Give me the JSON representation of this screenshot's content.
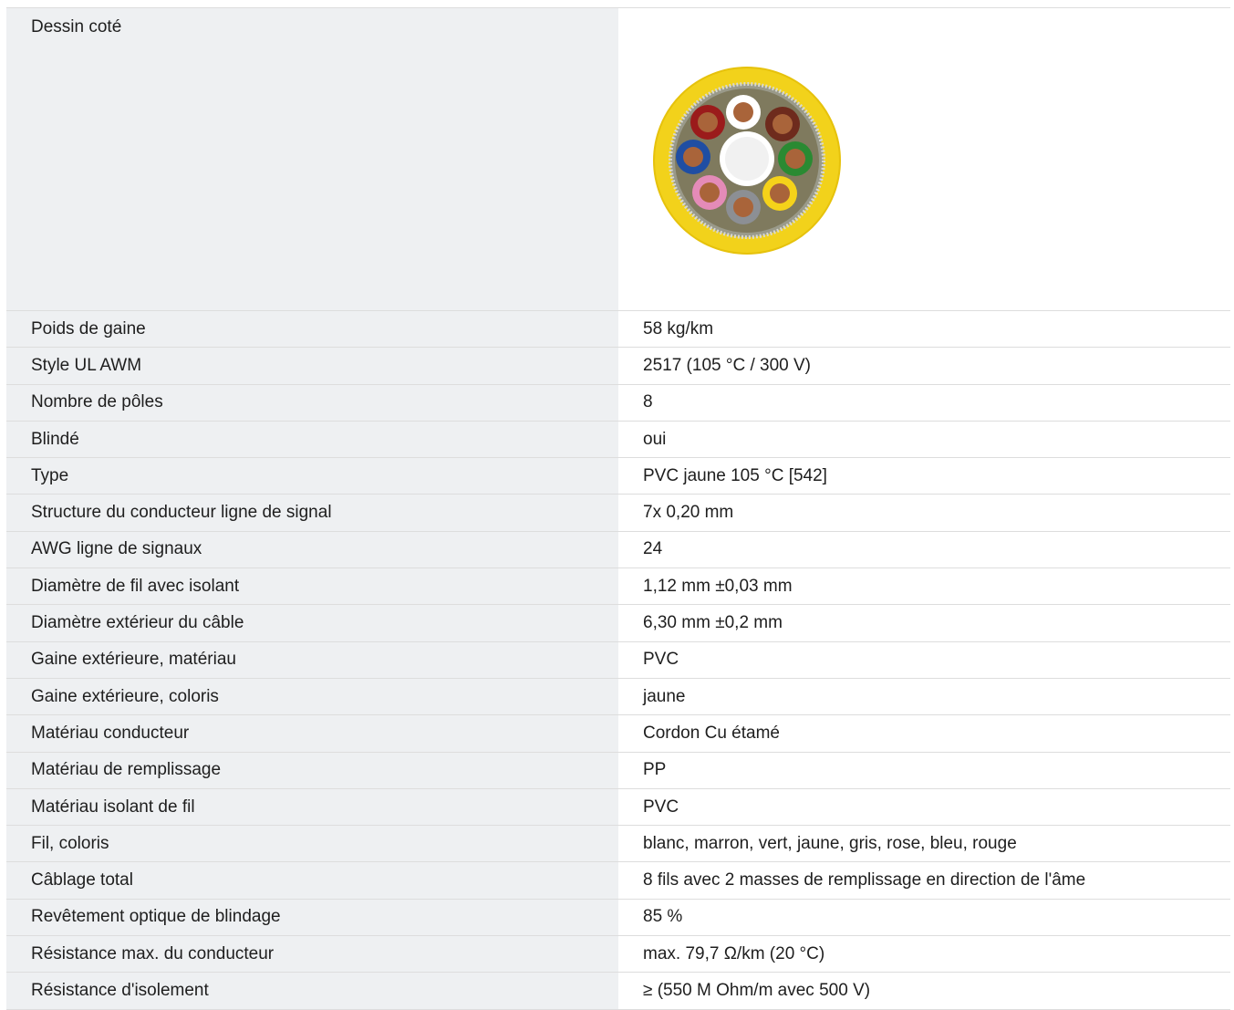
{
  "drawing": {
    "label": "Dessin coté",
    "image_icon": "cable-cross-section-icon"
  },
  "specs": [
    {
      "label": "Poids de gaine",
      "value": "58 kg/km"
    },
    {
      "label": "Style UL AWM",
      "value": "2517 (105 °C / 300 V)"
    },
    {
      "label": "Nombre de pôles",
      "value": "8"
    },
    {
      "label": "Blindé",
      "value": "oui"
    },
    {
      "label": "Type",
      "value": "PVC jaune 105 °C [542]"
    },
    {
      "label": "Structure du conducteur ligne de signal",
      "value": "7x 0,20 mm"
    },
    {
      "label": "AWG ligne de signaux",
      "value": "24"
    },
    {
      "label": "Diamètre de fil avec isolant",
      "value": "1,12 mm ±0,03 mm"
    },
    {
      "label": "Diamètre extérieur du câble",
      "value": "6,30 mm ±0,2 mm"
    },
    {
      "label": "Gaine extérieure, matériau",
      "value": "PVC"
    },
    {
      "label": "Gaine extérieure, coloris",
      "value": "jaune"
    },
    {
      "label": "Matériau conducteur",
      "value": "Cordon Cu étamé"
    },
    {
      "label": "Matériau de remplissage",
      "value": "PP"
    },
    {
      "label": "Matériau isolant de fil",
      "value": "PVC"
    },
    {
      "label": "Fil, coloris",
      "value": "blanc, marron, vert, jaune, gris, rose, bleu, rouge"
    },
    {
      "label": "Câblage total",
      "value": "8 fils avec 2 masses de remplissage en direction de l'âme"
    },
    {
      "label": "Revêtement optique de blindage",
      "value": "85 %"
    },
    {
      "label": "Résistance max. du conducteur",
      "value": "max. 79,7 Ω/km (20 °C)"
    },
    {
      "label": "Résistance d'isolement",
      "value": "≥ (550 M Ohm/m avec 500 V)"
    }
  ],
  "colors": {
    "jacket": "#f2d21b",
    "label_bg": "#eef0f2",
    "divider": "#dddddd"
  }
}
